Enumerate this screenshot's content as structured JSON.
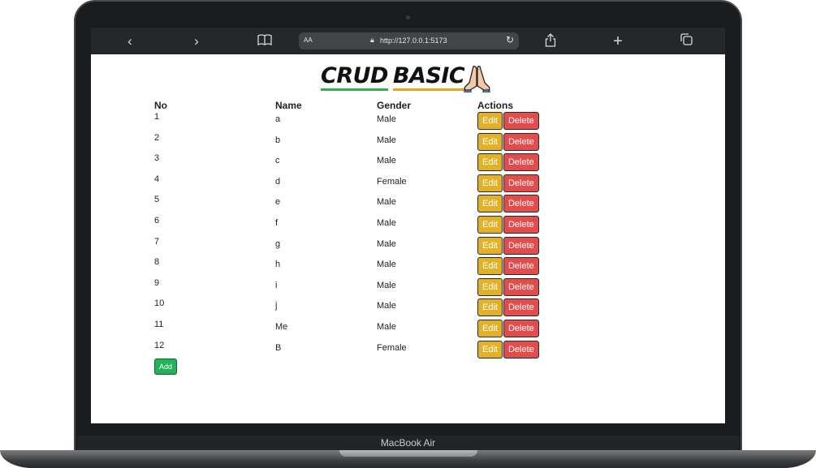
{
  "browser": {
    "url": "http://127.0.0.1:5173",
    "aa_label": "AA",
    "back_icon": "chevron-left-icon",
    "forward_icon": "chevron-right-icon"
  },
  "page": {
    "title_word1": "CRUD",
    "title_word2": "BASIC",
    "title_emoji": "folded-hands"
  },
  "table": {
    "headers": [
      "No",
      "Name",
      "Gender",
      "Actions"
    ],
    "rows": [
      {
        "no": "1",
        "name": "a",
        "gender": "Male"
      },
      {
        "no": "2",
        "name": "b",
        "gender": "Male"
      },
      {
        "no": "3",
        "name": "c",
        "gender": "Male"
      },
      {
        "no": "4",
        "name": "d",
        "gender": "Female"
      },
      {
        "no": "5",
        "name": "e",
        "gender": "Male"
      },
      {
        "no": "6",
        "name": "f",
        "gender": "Male"
      },
      {
        "no": "7",
        "name": "g",
        "gender": "Male"
      },
      {
        "no": "8",
        "name": "h",
        "gender": "Male"
      },
      {
        "no": "9",
        "name": "i",
        "gender": "Male"
      },
      {
        "no": "10",
        "name": "j",
        "gender": "Male"
      },
      {
        "no": "11",
        "name": "Me",
        "gender": "Male"
      },
      {
        "no": "12",
        "name": "B",
        "gender": "Female"
      }
    ],
    "edit_label": "Edit",
    "delete_label": "Delete"
  },
  "add_label": "Add",
  "device_label": "MacBook Air",
  "colors": {
    "edit": "#e3b128",
    "delete": "#e24c4c",
    "add": "#22b35a",
    "title_underline_1": "#2bb34a",
    "title_underline_2": "#f0a020"
  }
}
